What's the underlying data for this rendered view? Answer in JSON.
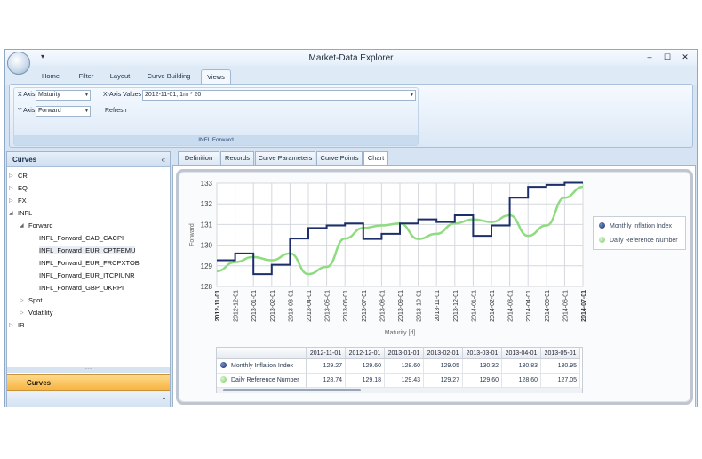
{
  "window": {
    "title": "Market-Data Explorer",
    "qat": "▾"
  },
  "ribbon": {
    "tabs": [
      "Home",
      "Filter",
      "Layout",
      "Curve Building",
      "Views"
    ],
    "x_axis_label": "X Axis",
    "x_axis_value": "Maturity",
    "y_axis_label": "Y Axis",
    "y_axis_value": "Forward",
    "x_values_label": "X-Axis Values",
    "x_values_value": "2012-11-01, 1m * 20",
    "refresh": "Refresh",
    "group_label": "INFL Forward"
  },
  "left_pane": {
    "header": "Curves",
    "collapse": "«",
    "nav_button": "Curves",
    "tree": [
      {
        "label": "CR",
        "level": 0,
        "expandable": true
      },
      {
        "label": "EQ",
        "level": 0,
        "expandable": true
      },
      {
        "label": "FX",
        "level": 0,
        "expandable": true
      },
      {
        "label": "INFL",
        "level": 0,
        "expandable": true,
        "expanded": true
      },
      {
        "label": "Forward",
        "level": 1,
        "expandable": true,
        "expanded": true
      },
      {
        "label": "INFL_Forward_CAD_CACPI",
        "level": 2
      },
      {
        "label": "INFL_Forward_EUR_CPTFEMU",
        "level": 2,
        "selected": true
      },
      {
        "label": "INFL_Forward_EUR_FRCPXTOB",
        "level": 2
      },
      {
        "label": "INFL_Forward_EUR_ITCPIUNR",
        "level": 2
      },
      {
        "label": "INFL_Forward_GBP_UKRPI",
        "level": 2
      },
      {
        "label": "Spot",
        "level": 1,
        "expandable": true
      },
      {
        "label": "Volatility",
        "level": 1,
        "expandable": true
      },
      {
        "label": "IR",
        "level": 0,
        "expandable": true
      }
    ]
  },
  "doc_tabs": [
    "Definition",
    "Records",
    "Curve Parameters",
    "Curve Points",
    "Chart"
  ],
  "active_doc_tab": "Chart",
  "colors": {
    "monthly": "#1c2f6b",
    "daily": "#8fdc80"
  },
  "chart_data": {
    "type": "line",
    "xlabel": "Maturity [d]",
    "ylabel": "Forward",
    "ylim": [
      128,
      133
    ],
    "yticks": [
      128,
      129,
      130,
      131,
      132,
      133
    ],
    "x": [
      "2012-11-01",
      "2012-12-01",
      "2013-01-01",
      "2013-02-01",
      "2013-03-01",
      "2013-04-01",
      "2013-05-01",
      "2013-06-01",
      "2013-07-01",
      "2013-08-01",
      "2013-09-01",
      "2013-10-01",
      "2013-11-01",
      "2013-12-01",
      "2014-01-01",
      "2014-02-01",
      "2014-03-01",
      "2014-04-01",
      "2014-05-01",
      "2014-06-01",
      "2014-07-01"
    ],
    "series": [
      {
        "name": "Monthly Inflation Index",
        "style": "step",
        "values": [
          129.27,
          129.6,
          128.6,
          129.05,
          130.32,
          130.83,
          130.95,
          131.05,
          130.3,
          130.55,
          131.05,
          131.25,
          131.12,
          131.45,
          130.45,
          130.95,
          132.3,
          132.82,
          132.92,
          133.02,
          133.02
        ]
      },
      {
        "name": "Daily Reference Number",
        "style": "smooth",
        "values": [
          128.74,
          129.18,
          129.43,
          129.27,
          129.6,
          128.6,
          128.95,
          130.32,
          130.83,
          130.95,
          131.05,
          130.3,
          130.55,
          131.05,
          131.25,
          131.12,
          131.45,
          130.45,
          130.95,
          132.3,
          132.82
        ]
      }
    ],
    "legend": "right",
    "grid": true
  },
  "table": {
    "columns": [
      "2012-11-01",
      "2012-12-01",
      "2013-01-01",
      "2013-02-01",
      "2013-03-01",
      "2013-04-01",
      "2013-05-01"
    ],
    "rows": [
      {
        "label": "Monthly Inflation Index",
        "values": [
          "129.27",
          "129.60",
          "128.60",
          "129.05",
          "130.32",
          "130.83",
          "130.95"
        ]
      },
      {
        "label": "Daily Reference Number",
        "values": [
          "128.74",
          "129.18",
          "129.43",
          "129.27",
          "129.60",
          "128.60",
          "127.05"
        ]
      }
    ]
  }
}
